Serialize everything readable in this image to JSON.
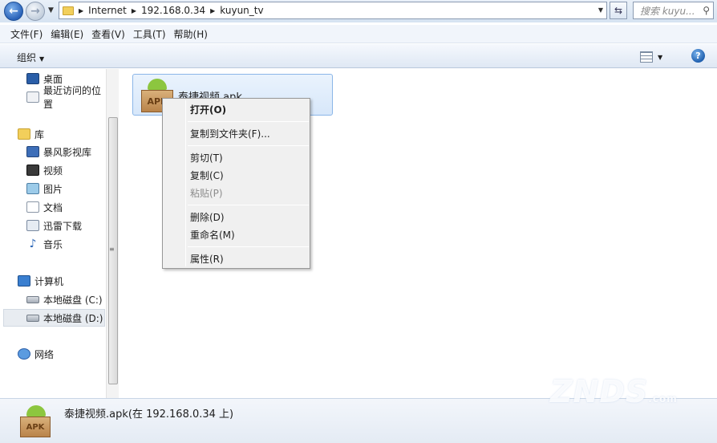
{
  "address_bar": {
    "crumbs": [
      "Internet",
      "192.168.0.34",
      "kuyun_tv"
    ],
    "search_placeholder": "搜索 kuyu..."
  },
  "menu": [
    "文件(F)",
    "编辑(E)",
    "查看(V)",
    "工具(T)",
    "帮助(H)"
  ],
  "toolbar": {
    "organize": "组织",
    "help": "?"
  },
  "nav_pane": {
    "items": [
      {
        "label": "桌面",
        "icon": "desktop-icon"
      },
      {
        "label": "最近访问的位置",
        "icon": "recent-places-icon"
      },
      {
        "label": "库",
        "icon": "library-icon"
      },
      {
        "label": "暴风影视库",
        "icon": "video-library-icon"
      },
      {
        "label": "视频",
        "icon": "video-icon"
      },
      {
        "label": "图片",
        "icon": "pictures-icon"
      },
      {
        "label": "文档",
        "icon": "documents-icon"
      },
      {
        "label": "迅雷下载",
        "icon": "downloads-icon"
      },
      {
        "label": "音乐",
        "icon": "music-icon"
      },
      {
        "label": "计算机",
        "icon": "computer-icon"
      },
      {
        "label": "本地磁盘 (C:)",
        "icon": "drive-icon"
      },
      {
        "label": "本地磁盘 (D:)",
        "icon": "drive-icon",
        "selected": true
      },
      {
        "label": "网络",
        "icon": "network-icon"
      }
    ]
  },
  "file": {
    "name": "泰捷视频.apk",
    "icon_label": "APK"
  },
  "context_menu": {
    "items": [
      {
        "label": "打开(O)",
        "bold": true
      },
      {
        "label": "复制到文件夹(F)..."
      },
      {
        "label": "剪切(T)"
      },
      {
        "label": "复制(C)"
      },
      {
        "label": "粘贴(P)",
        "disabled": true
      },
      {
        "label": "删除(D)"
      },
      {
        "label": "重命名(M)"
      },
      {
        "label": "属性(R)"
      }
    ]
  },
  "details_pane": {
    "text": "泰捷视频.apk(在 192.168.0.34 上)",
    "icon_label": "APK"
  },
  "watermark": {
    "text": "ZNDS",
    "suffix": ".com"
  }
}
